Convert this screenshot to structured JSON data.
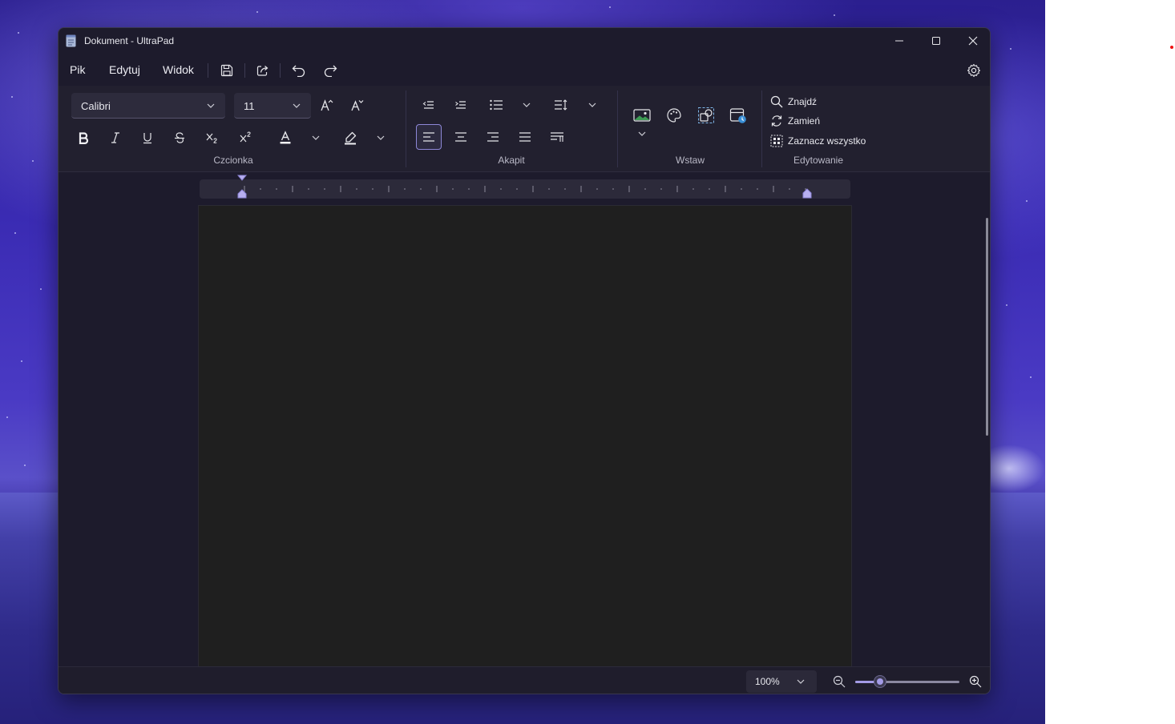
{
  "window": {
    "title": "Dokument - UltraPad"
  },
  "menu": {
    "file": "Pik",
    "edit": "Edytuj",
    "view": "Widok"
  },
  "ribbon": {
    "font": {
      "family": "Calibri",
      "size": "11",
      "group_label": "Czcionka"
    },
    "paragraph": {
      "group_label": "Akapit",
      "active_alignment": "left"
    },
    "insert": {
      "group_label": "Wstaw"
    },
    "editing": {
      "find": "Znajdź",
      "replace": "Zamień",
      "select_all": "Zaznacz wszystko",
      "group_label": "Edytowanie"
    }
  },
  "status": {
    "zoom": "100%",
    "zoom_slider_fraction": 0.24
  },
  "colors": {
    "accent": "#a39be6",
    "window_bg": "#1d1b2c",
    "page_bg": "#1f1f1f"
  }
}
